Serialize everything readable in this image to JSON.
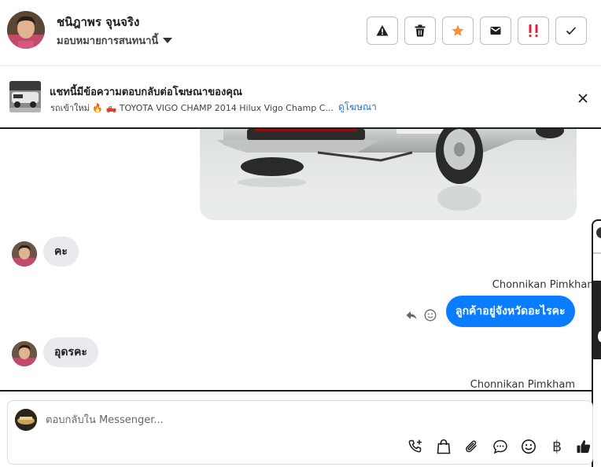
{
  "header": {
    "contact_name": "ชนิฎาพร จุนจริง",
    "assign_label": "มอบหมายการสนทนานี้",
    "actions": [
      {
        "name": "report",
        "icon": "warning-icon"
      },
      {
        "name": "delete",
        "icon": "trash-icon"
      },
      {
        "name": "star",
        "icon": "star-icon",
        "color": "#f7923a"
      },
      {
        "name": "mark-unread",
        "icon": "envelope-icon"
      },
      {
        "name": "mark-spam",
        "icon": "spam-icon",
        "color": "#e41e3f"
      },
      {
        "name": "mark-done",
        "icon": "check-icon"
      }
    ]
  },
  "ad_banner": {
    "title": "แชทนี้มีข้อความตอบกลับต่อโฆษณาของคุณ",
    "subtitle": "รถเข้าใหม่ 🔥 🛻 TOYOTA VIGO CHAMP 2014 Hilux Vigo Champ C...",
    "subtitle_prefix_icon": "fire-icon",
    "link_label": "ดูโฆษณา"
  },
  "messages": [
    {
      "direction": "incoming",
      "text": "คะ"
    },
    {
      "direction": "outgoing",
      "sender": "Chonnikan Pimkham",
      "text": "ลูกค้าอยู่จังหวัดอะไรคะ"
    },
    {
      "direction": "incoming",
      "text": "อุดรคะ"
    },
    {
      "direction": "outgoing",
      "sender": "Chonnikan Pimkham",
      "text": ""
    }
  ],
  "composer": {
    "placeholder": "ตอบกลับใน Messenger...",
    "value": "",
    "tools": [
      "call-plus-icon",
      "shopping-bag-icon",
      "paperclip-icon",
      "chat-bubble-icon",
      "smiley-icon",
      "baht-icon",
      "thumbs-up-icon"
    ],
    "baht_symbol": "฿"
  },
  "colors": {
    "brand_blue": "#0a7cff",
    "link_blue": "#1877f2",
    "incoming_bubble": "#e9eaed",
    "star_orange": "#f7923a",
    "spam_red": "#e41e3f"
  }
}
